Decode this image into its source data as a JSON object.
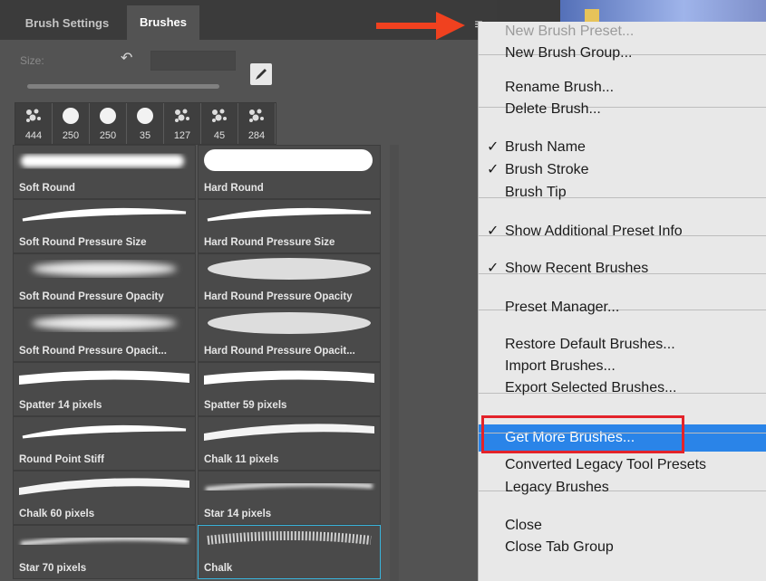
{
  "panel": {
    "tabs": [
      "Brush Settings",
      "Brushes"
    ],
    "size_label": "Size:",
    "recent_brushes": [
      "444",
      "250",
      "250",
      "35",
      "127",
      "45",
      "284"
    ],
    "presets": [
      "Soft Round",
      "Hard Round",
      "Soft Round Pressure Size",
      "Hard Round Pressure Size",
      "Soft Round Pressure Opacity",
      "Hard Round Pressure Opacity",
      "Soft Round Pressure Opacit...",
      "Hard Round Pressure Opacit...",
      "Spatter 14 pixels",
      "Spatter 59 pixels",
      "Round Point Stiff",
      "Chalk 11 pixels",
      "Chalk 60 pixels",
      "Star 14 pixels",
      "Star 70 pixels",
      "Chalk"
    ],
    "selected_preset": "Chalk"
  },
  "menu": {
    "items": [
      {
        "label": "New Brush Preset...",
        "disabled": true,
        "checked": false
      },
      {
        "label": "New Brush Group...",
        "disabled": false,
        "checked": false
      },
      {
        "label": "Rename Brush...",
        "disabled": false,
        "checked": false
      },
      {
        "label": "Delete Brush...",
        "disabled": false,
        "checked": false
      },
      {
        "label": "Brush Name",
        "disabled": false,
        "checked": true
      },
      {
        "label": "Brush Stroke",
        "disabled": false,
        "checked": true
      },
      {
        "label": "Brush Tip",
        "disabled": false,
        "checked": false
      },
      {
        "label": "Show Additional Preset Info",
        "disabled": false,
        "checked": true
      },
      {
        "label": "Show Recent Brushes",
        "disabled": false,
        "checked": true
      },
      {
        "label": "Preset Manager...",
        "disabled": false,
        "checked": false
      },
      {
        "label": "Restore Default Brushes...",
        "disabled": false,
        "checked": false
      },
      {
        "label": "Import Brushes...",
        "disabled": false,
        "checked": false
      },
      {
        "label": "Export Selected Brushes...",
        "disabled": false,
        "checked": false
      },
      {
        "label": "Get More Brushes...",
        "disabled": false,
        "checked": false,
        "highlighted": true
      },
      {
        "label": "Converted Legacy Tool Presets",
        "disabled": false,
        "checked": false
      },
      {
        "label": "Legacy Brushes",
        "disabled": false,
        "checked": false
      },
      {
        "label": "Close",
        "disabled": false,
        "checked": false
      },
      {
        "label": "Close Tab Group",
        "disabled": false,
        "checked": false
      }
    ],
    "check_glyph": "✓",
    "hamburger_glyph": "≡"
  },
  "colors": {
    "panel_bg": "#535353",
    "menu_bg": "#e8e8e8",
    "highlight": "#2a84e8",
    "annotation_red": "#e3232a",
    "selected_border": "#39b4dc"
  },
  "icons": [
    "hamburger-menu-icon",
    "reset-icon",
    "brush-edit-icon",
    "checkmark-icon",
    "red-arrow-annotation"
  ]
}
